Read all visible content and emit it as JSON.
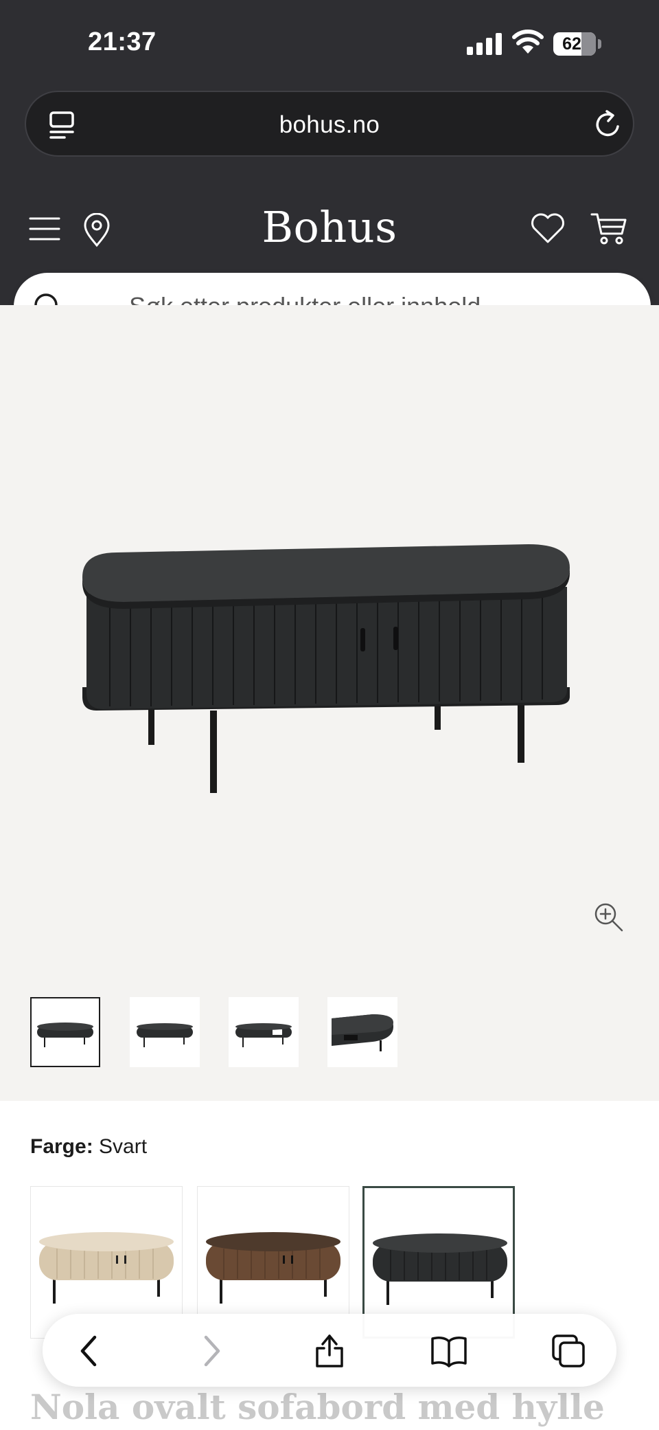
{
  "status_bar": {
    "time": "21:37",
    "battery": "62"
  },
  "browser": {
    "url": "bohus.no"
  },
  "site_header": {
    "brand": "Bohus"
  },
  "search": {
    "placeholder": "Søk etter produkter eller innhold ..."
  },
  "gallery": {
    "thumbnails": [
      "thumbnail-1",
      "thumbnail-2",
      "thumbnail-3",
      "thumbnail-4"
    ],
    "active_index": 0
  },
  "color_selector": {
    "label": "Farge:",
    "selected_value": "Svart",
    "options": [
      {
        "name": "light-oak",
        "color": "#d8c8ad"
      },
      {
        "name": "walnut",
        "color": "#6a4a34"
      },
      {
        "name": "black",
        "color": "#2b2d2e"
      }
    ]
  },
  "product": {
    "title": "Nola ovalt sofabord med hylle"
  },
  "colors": {
    "header_bg": "#2e2e32",
    "image_bg": "#f4f3f1",
    "table": "#2b2d2e"
  }
}
